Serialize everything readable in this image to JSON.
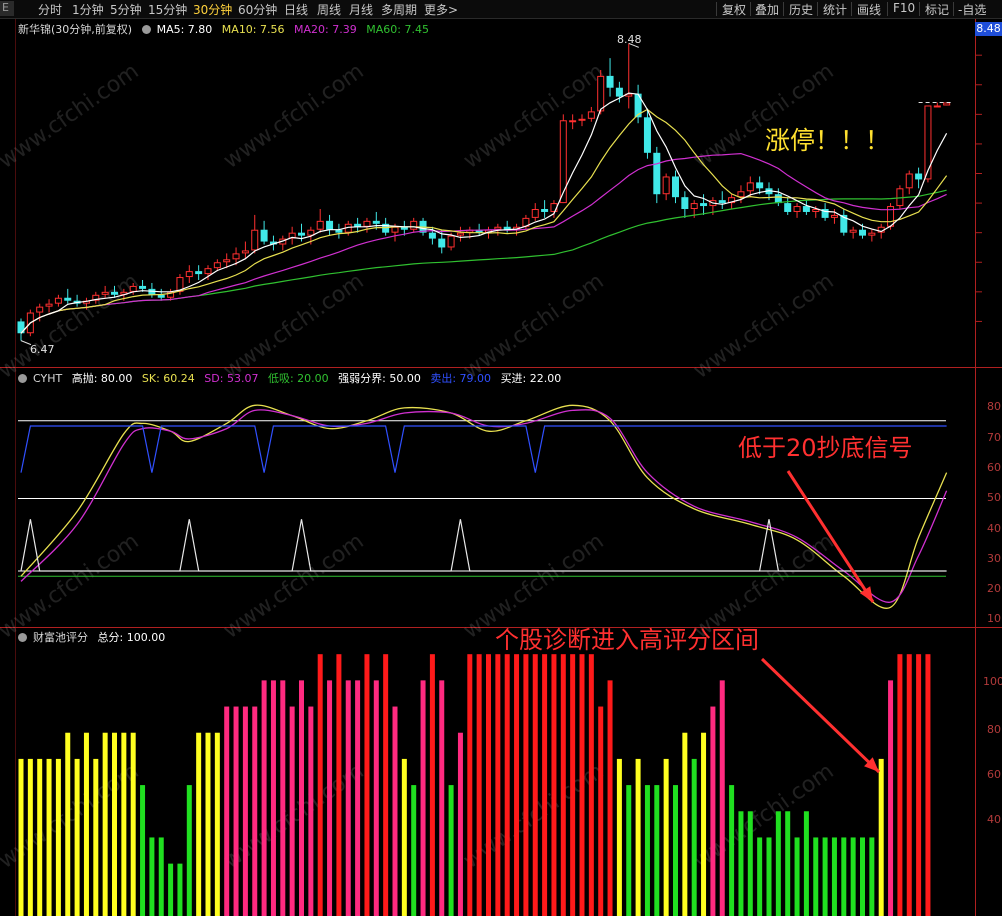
{
  "toolbar": {
    "timeframes": [
      "分时",
      "1分钟",
      "5分钟",
      "15分钟",
      "30分钟",
      "60分钟",
      "日线",
      "周线",
      "月线",
      "多周期",
      "更多"
    ],
    "active_timeframe": "30分钟",
    "more_suffix": ">",
    "right_buttons": [
      "复权",
      "叠加",
      "历史",
      "统计",
      "画线",
      "F10",
      "标记",
      "-自选"
    ],
    "left_edge_label": "E"
  },
  "panel_main": {
    "title": "新华锦(30分钟,前复权)",
    "ma": [
      {
        "label": "MA5: 7.80",
        "color": "#ffffff"
      },
      {
        "label": "MA10: 7.56",
        "color": "#e8e050"
      },
      {
        "label": "MA20: 7.39",
        "color": "#d030d0"
      },
      {
        "label": "MA60: 7.45",
        "color": "#30c030"
      }
    ],
    "high_label": "8.48",
    "low_label": "6.47",
    "price_badge": "8.48",
    "annotation": "涨停！！！",
    "annotation_color": "#ffe030"
  },
  "panel_cyht": {
    "title": "CYHT",
    "items": [
      {
        "label": "高抛: 80.00",
        "color": "#ffffff"
      },
      {
        "label": "SK: 60.24",
        "color": "#e8e050"
      },
      {
        "label": "SD: 53.07",
        "color": "#d030d0"
      },
      {
        "label": "低吸: 20.00",
        "color": "#30c030"
      },
      {
        "label": "强弱分界: 50.00",
        "color": "#ffffff"
      },
      {
        "label": "卖出: 79.00",
        "color": "#3050ff"
      },
      {
        "label": "买进: 22.00",
        "color": "#ffffff"
      }
    ],
    "annotation": "低于20抄底信号",
    "annotation_color": "#ff3030",
    "axis_ticks": [
      "80",
      "70",
      "60",
      "50",
      "40",
      "30",
      "20",
      "10"
    ]
  },
  "panel_score": {
    "title": "财富池评分",
    "items": [
      {
        "label": "总分: 100.00",
        "color": "#ffffff"
      }
    ],
    "annotation": "个股诊断进入高评分区间",
    "annotation_color": "#ff3030",
    "axis_ticks": [
      "100",
      "80",
      "60",
      "40"
    ]
  },
  "watermark": "www.cfchi.com",
  "colors": {
    "up": "#ff3030",
    "down": "#40e8e8",
    "axis": "#b02020",
    "score_yellow": "#ffff20",
    "score_green": "#20e020",
    "score_pink": "#ff2a80",
    "score_red": "#ff1a1a"
  },
  "chart_data": [
    {
      "type": "candlestick",
      "title": "新华锦(30分钟,前复权)",
      "y_range": [
        6.4,
        8.55
      ],
      "max_price": 8.48,
      "min_price": 6.47,
      "ohlc": [
        [
          6.6,
          6.62,
          6.47,
          6.52
        ],
        [
          6.52,
          6.68,
          6.5,
          6.66
        ],
        [
          6.66,
          6.72,
          6.6,
          6.7
        ],
        [
          6.7,
          6.75,
          6.66,
          6.72
        ],
        [
          6.72,
          6.78,
          6.7,
          6.76
        ],
        [
          6.76,
          6.82,
          6.72,
          6.74
        ],
        [
          6.74,
          6.78,
          6.7,
          6.72
        ],
        [
          6.72,
          6.76,
          6.68,
          6.74
        ],
        [
          6.74,
          6.8,
          6.72,
          6.78
        ],
        [
          6.78,
          6.84,
          6.76,
          6.8
        ],
        [
          6.8,
          6.84,
          6.76,
          6.78
        ],
        [
          6.78,
          6.82,
          6.74,
          6.8
        ],
        [
          6.8,
          6.86,
          6.78,
          6.84
        ],
        [
          6.84,
          6.88,
          6.8,
          6.82
        ],
        [
          6.82,
          6.86,
          6.76,
          6.78
        ],
        [
          6.78,
          6.82,
          6.74,
          6.76
        ],
        [
          6.76,
          6.82,
          6.74,
          6.8
        ],
        [
          6.8,
          6.92,
          6.78,
          6.9
        ],
        [
          6.9,
          6.98,
          6.86,
          6.94
        ],
        [
          6.94,
          6.98,
          6.88,
          6.92
        ],
        [
          6.92,
          6.98,
          6.88,
          6.96
        ],
        [
          6.96,
          7.02,
          6.94,
          7.0
        ],
        [
          7.0,
          7.06,
          6.96,
          7.02
        ],
        [
          7.02,
          7.1,
          6.98,
          7.06
        ],
        [
          7.06,
          7.14,
          7.02,
          7.08
        ],
        [
          7.08,
          7.32,
          7.06,
          7.22
        ],
        [
          7.22,
          7.28,
          7.12,
          7.14
        ],
        [
          7.14,
          7.18,
          7.08,
          7.12
        ],
        [
          7.12,
          7.18,
          7.08,
          7.16
        ],
        [
          7.16,
          7.24,
          7.12,
          7.2
        ],
        [
          7.2,
          7.26,
          7.14,
          7.18
        ],
        [
          7.18,
          7.24,
          7.12,
          7.22
        ],
        [
          7.22,
          7.36,
          7.2,
          7.28
        ],
        [
          7.28,
          7.32,
          7.18,
          7.22
        ],
        [
          7.22,
          7.26,
          7.16,
          7.2
        ],
        [
          7.2,
          7.28,
          7.18,
          7.26
        ],
        [
          7.26,
          7.3,
          7.2,
          7.24
        ],
        [
          7.24,
          7.3,
          7.2,
          7.28
        ],
        [
          7.28,
          7.34,
          7.22,
          7.26
        ],
        [
          7.26,
          7.3,
          7.18,
          7.2
        ],
        [
          7.2,
          7.26,
          7.14,
          7.24
        ],
        [
          7.24,
          7.28,
          7.18,
          7.22
        ],
        [
          7.22,
          7.3,
          7.2,
          7.28
        ],
        [
          7.28,
          7.3,
          7.18,
          7.2
        ],
        [
          7.2,
          7.24,
          7.12,
          7.16
        ],
        [
          7.16,
          7.22,
          7.06,
          7.1
        ],
        [
          7.1,
          7.2,
          7.08,
          7.18
        ],
        [
          7.18,
          7.24,
          7.14,
          7.2
        ],
        [
          7.2,
          7.24,
          7.16,
          7.22
        ],
        [
          7.22,
          7.26,
          7.18,
          7.2
        ],
        [
          7.2,
          7.24,
          7.16,
          7.22
        ],
        [
          7.22,
          7.26,
          7.18,
          7.24
        ],
        [
          7.24,
          7.28,
          7.2,
          7.22
        ],
        [
          7.22,
          7.26,
          7.18,
          7.24
        ],
        [
          7.24,
          7.32,
          7.22,
          7.3
        ],
        [
          7.3,
          7.4,
          7.28,
          7.36
        ],
        [
          7.36,
          7.42,
          7.3,
          7.34
        ],
        [
          7.34,
          7.42,
          7.3,
          7.4
        ],
        [
          7.4,
          8.0,
          7.4,
          7.96
        ],
        [
          7.96,
          8.0,
          7.9,
          7.96
        ],
        [
          7.96,
          8.0,
          7.92,
          7.97
        ],
        [
          7.97,
          8.05,
          7.95,
          8.02
        ],
        [
          8.02,
          8.3,
          8.0,
          8.26
        ],
        [
          8.26,
          8.38,
          8.12,
          8.18
        ],
        [
          8.18,
          8.22,
          8.08,
          8.12
        ],
        [
          8.12,
          8.48,
          8.04,
          8.14
        ],
        [
          8.14,
          8.2,
          7.94,
          7.98
        ],
        [
          7.98,
          8.04,
          7.7,
          7.74
        ],
        [
          7.74,
          7.78,
          7.4,
          7.46
        ],
        [
          7.46,
          7.6,
          7.42,
          7.58
        ],
        [
          7.58,
          7.62,
          7.4,
          7.44
        ],
        [
          7.44,
          7.48,
          7.3,
          7.36
        ],
        [
          7.36,
          7.42,
          7.3,
          7.4
        ],
        [
          7.4,
          7.46,
          7.32,
          7.38
        ],
        [
          7.38,
          7.44,
          7.32,
          7.42
        ],
        [
          7.42,
          7.48,
          7.36,
          7.4
        ],
        [
          7.4,
          7.46,
          7.36,
          7.44
        ],
        [
          7.44,
          7.52,
          7.4,
          7.48
        ],
        [
          7.48,
          7.58,
          7.44,
          7.54
        ],
        [
          7.54,
          7.58,
          7.46,
          7.5
        ],
        [
          7.5,
          7.54,
          7.42,
          7.46
        ],
        [
          7.46,
          7.5,
          7.38,
          7.4
        ],
        [
          7.4,
          7.44,
          7.32,
          7.34
        ],
        [
          7.34,
          7.4,
          7.3,
          7.38
        ],
        [
          7.38,
          7.42,
          7.32,
          7.34
        ],
        [
          7.34,
          7.38,
          7.3,
          7.36
        ],
        [
          7.36,
          7.4,
          7.28,
          7.3
        ],
        [
          7.3,
          7.36,
          7.26,
          7.32
        ],
        [
          7.32,
          7.36,
          7.18,
          7.2
        ],
        [
          7.2,
          7.24,
          7.16,
          7.22
        ],
        [
          7.22,
          7.26,
          7.16,
          7.18
        ],
        [
          7.18,
          7.22,
          7.14,
          7.2
        ],
        [
          7.2,
          7.26,
          7.16,
          7.24
        ],
        [
          7.24,
          7.4,
          7.22,
          7.38
        ],
        [
          7.38,
          7.52,
          7.36,
          7.5
        ],
        [
          7.5,
          7.62,
          7.46,
          7.6
        ],
        [
          7.6,
          7.64,
          7.5,
          7.56
        ],
        [
          7.56,
          8.06,
          7.54,
          8.06
        ],
        [
          8.06,
          8.08,
          8.06,
          8.06
        ],
        [
          8.06,
          8.08,
          8.06,
          8.08
        ]
      ]
    },
    {
      "type": "line",
      "title": "CYHT",
      "y_range": [
        0,
        100
      ],
      "reference_lines": [
        {
          "name": "高抛",
          "value": 80
        },
        {
          "name": "强弱分界",
          "value": 50
        },
        {
          "name": "买进",
          "value": 22
        },
        {
          "name": "低吸",
          "value": 20
        }
      ],
      "series": [
        {
          "name": "SK",
          "color": "#e8e050",
          "x": [
            0,
            6,
            11,
            13,
            16,
            18,
            22,
            25,
            29,
            33,
            37,
            41,
            46,
            50,
            54,
            59,
            63,
            67,
            72,
            78,
            83,
            88,
            93,
            96,
            99
          ],
          "values": [
            20,
            45,
            75,
            79,
            76,
            72,
            79,
            86,
            82,
            77,
            80,
            85,
            83,
            76,
            80,
            86,
            80,
            58,
            46,
            40,
            34,
            20,
            8,
            35,
            60
          ]
        },
        {
          "name": "SD",
          "color": "#d030d0",
          "x": [
            0,
            6,
            11,
            13,
            16,
            18,
            22,
            25,
            29,
            33,
            37,
            41,
            46,
            50,
            54,
            59,
            63,
            67,
            72,
            78,
            83,
            88,
            93,
            96,
            99
          ],
          "values": [
            18,
            40,
            71,
            77,
            76,
            73,
            77,
            84,
            82,
            78,
            79,
            83,
            83,
            78,
            79,
            84,
            81,
            60,
            47,
            41,
            35,
            22,
            10,
            28,
            53
          ]
        },
        {
          "name": "卖出",
          "color": "#3050ff",
          "x": [
            0,
            1,
            13,
            14,
            15,
            25,
            26,
            27,
            39,
            40,
            41,
            54,
            55,
            56,
            99
          ],
          "values": [
            60,
            78,
            78,
            60,
            78,
            78,
            60,
            78,
            78,
            60,
            78,
            78,
            60,
            78,
            78
          ]
        },
        {
          "name": "signal",
          "color": "#e8e8e8",
          "x": [
            0,
            1,
            2,
            3,
            17,
            18,
            19,
            29,
            30,
            31,
            46,
            47,
            48,
            79,
            80,
            81,
            99
          ],
          "values": [
            22,
            42,
            22,
            22,
            22,
            42,
            22,
            22,
            42,
            22,
            22,
            42,
            22,
            22,
            42,
            22,
            22
          ]
        }
      ]
    },
    {
      "type": "bar",
      "title": "财富池评分",
      "y_range": [
        0,
        110
      ],
      "values": [
        60,
        60,
        60,
        60,
        60,
        70,
        60,
        70,
        60,
        70,
        70,
        70,
        70,
        50,
        30,
        30,
        20,
        20,
        50,
        70,
        70,
        70,
        80,
        80,
        80,
        80,
        90,
        90,
        90,
        80,
        90,
        80,
        100,
        90,
        100,
        90,
        90,
        100,
        90,
        100,
        80,
        60,
        50,
        90,
        100,
        90,
        50,
        70,
        100,
        100,
        100,
        100,
        100,
        100,
        100,
        100,
        100,
        100,
        100,
        100,
        100,
        100,
        80,
        90,
        60,
        50,
        60,
        50,
        50,
        60,
        50,
        70,
        60,
        70,
        80,
        90,
        50,
        40,
        40,
        30,
        30,
        40,
        40,
        30,
        40,
        30,
        30,
        30,
        30,
        30,
        30,
        30,
        60,
        90,
        100,
        100,
        100,
        100
      ],
      "colors": [
        "y",
        "y",
        "y",
        "y",
        "y",
        "y",
        "y",
        "y",
        "y",
        "y",
        "y",
        "y",
        "y",
        "g",
        "g",
        "g",
        "g",
        "g",
        "g",
        "y",
        "y",
        "y",
        "p",
        "p",
        "p",
        "p",
        "p",
        "p",
        "p",
        "p",
        "p",
        "p",
        "r",
        "p",
        "r",
        "p",
        "p",
        "r",
        "p",
        "r",
        "p",
        "y",
        "g",
        "p",
        "r",
        "p",
        "g",
        "p",
        "r",
        "r",
        "r",
        "r",
        "r",
        "r",
        "r",
        "r",
        "r",
        "r",
        "r",
        "r",
        "r",
        "r",
        "r",
        "r",
        "y",
        "g",
        "y",
        "g",
        "g",
        "y",
        "g",
        "y",
        "g",
        "y",
        "p",
        "p",
        "g",
        "g",
        "g",
        "g",
        "g",
        "g",
        "g",
        "g",
        "g",
        "g",
        "g",
        "g",
        "g",
        "g",
        "g",
        "g",
        "y",
        "p",
        "r",
        "r",
        "r",
        "r"
      ]
    }
  ]
}
